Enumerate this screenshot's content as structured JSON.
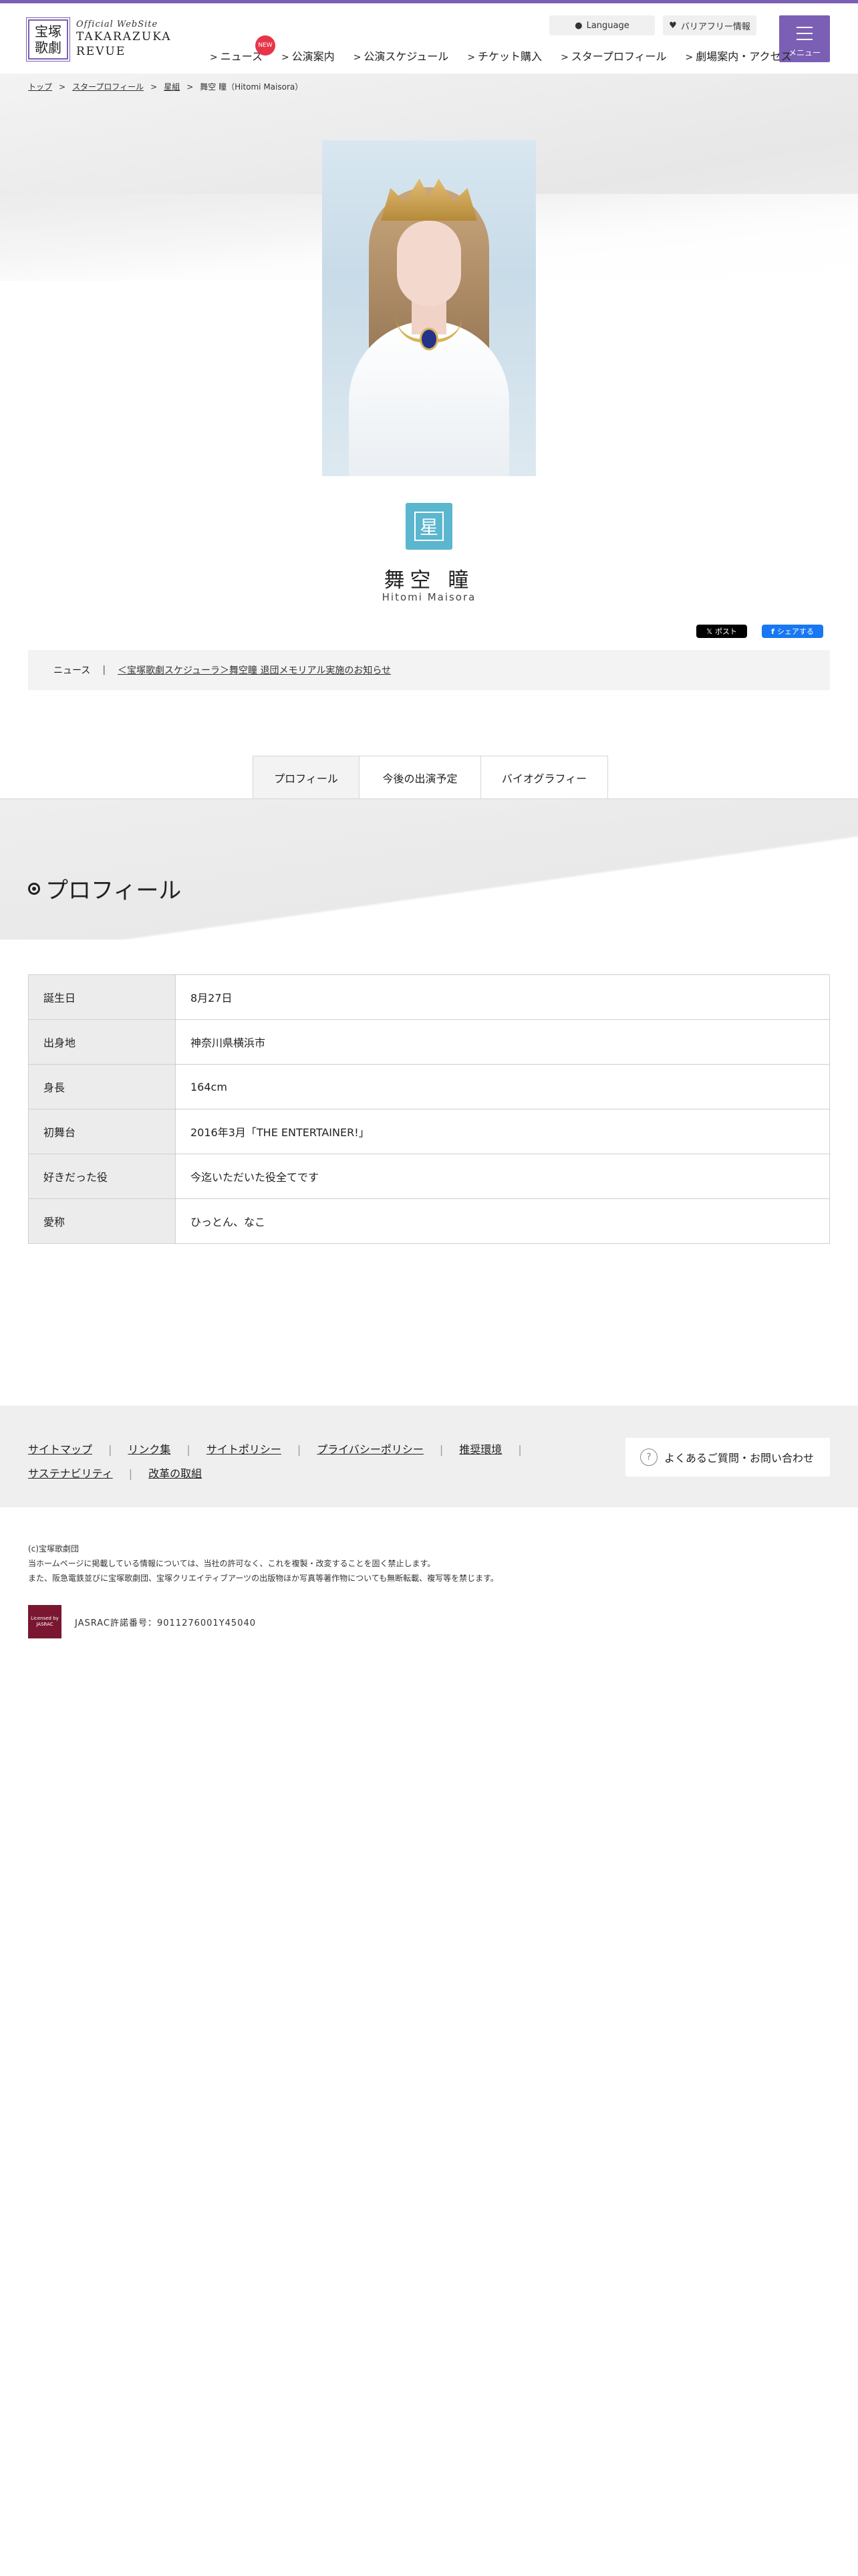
{
  "header": {
    "logo_emblem_top": "宝塚",
    "logo_emblem_bottom": "歌劇",
    "logo_sub": "Official WebSite",
    "logo_main_1": "TAKARAZUKA",
    "logo_main_2": "REVUE",
    "language_label": "Language",
    "barrier_free_label": "バリアフリー情報",
    "menu_label": "メニュー",
    "new_badge": "NEW",
    "nav": [
      {
        "label": "ニュース"
      },
      {
        "label": "公演案内"
      },
      {
        "label": "公演スケジュール"
      },
      {
        "label": "チケット購入"
      },
      {
        "label": "スタープロフィール"
      },
      {
        "label": "劇場案内・アクセス"
      }
    ]
  },
  "breadcrumb": [
    "トップ",
    "スタープロフィール",
    "星組",
    "舞空 瞳（Hitomi Maisora）"
  ],
  "star": {
    "troupe_icon_char": "星",
    "name_ja": "舞空 瞳",
    "name_en": "Hitomi Maisora"
  },
  "share": {
    "x_label": "ポスト",
    "fb_label": "シェアする"
  },
  "news": {
    "label": "ニュース",
    "separator": "|",
    "link": "＜宝塚歌劇スケジューラ＞舞空瞳 退団メモリアル実施のお知らせ"
  },
  "tabs": [
    "プロフィール",
    "今後の出演予定",
    "バイオグラフィー"
  ],
  "profile": {
    "title": "プロフィール",
    "rows": [
      {
        "key": "誕生日",
        "value": "8月27日"
      },
      {
        "key": "出身地",
        "value": "神奈川県横浜市"
      },
      {
        "key": "身長",
        "value": "164cm"
      },
      {
        "key": "初舞台",
        "value": "2016年3月「THE ENTERTAINER!」"
      },
      {
        "key": "好きだった役",
        "value": "今迄いただいた役全てです"
      },
      {
        "key": "愛称",
        "value": "ひっとん、なこ"
      }
    ]
  },
  "footer": {
    "links": [
      "サイトマップ",
      "リンク集",
      "サイトポリシー",
      "プライバシーポリシー",
      "推奨環境",
      "サステナビリティ",
      "改革の取組"
    ],
    "faq": "よくあるご質問・お問い合わせ",
    "copyright": "(c)宝塚歌劇団",
    "notice_1": "当ホームページに掲載している情報については、当社の許可なく、これを複製・改変することを固く禁止します。",
    "notice_2": "また、阪急電鉄並びに宝塚歌劇団、宝塚クリエイティブアーツの出版物ほか写真等著作物についても無断転載、複写等を禁じます。",
    "jasrac_logo": "Licensed by JASRAC",
    "jasrac_text": "JASRAC許諾番号：9011276001Y45040"
  }
}
